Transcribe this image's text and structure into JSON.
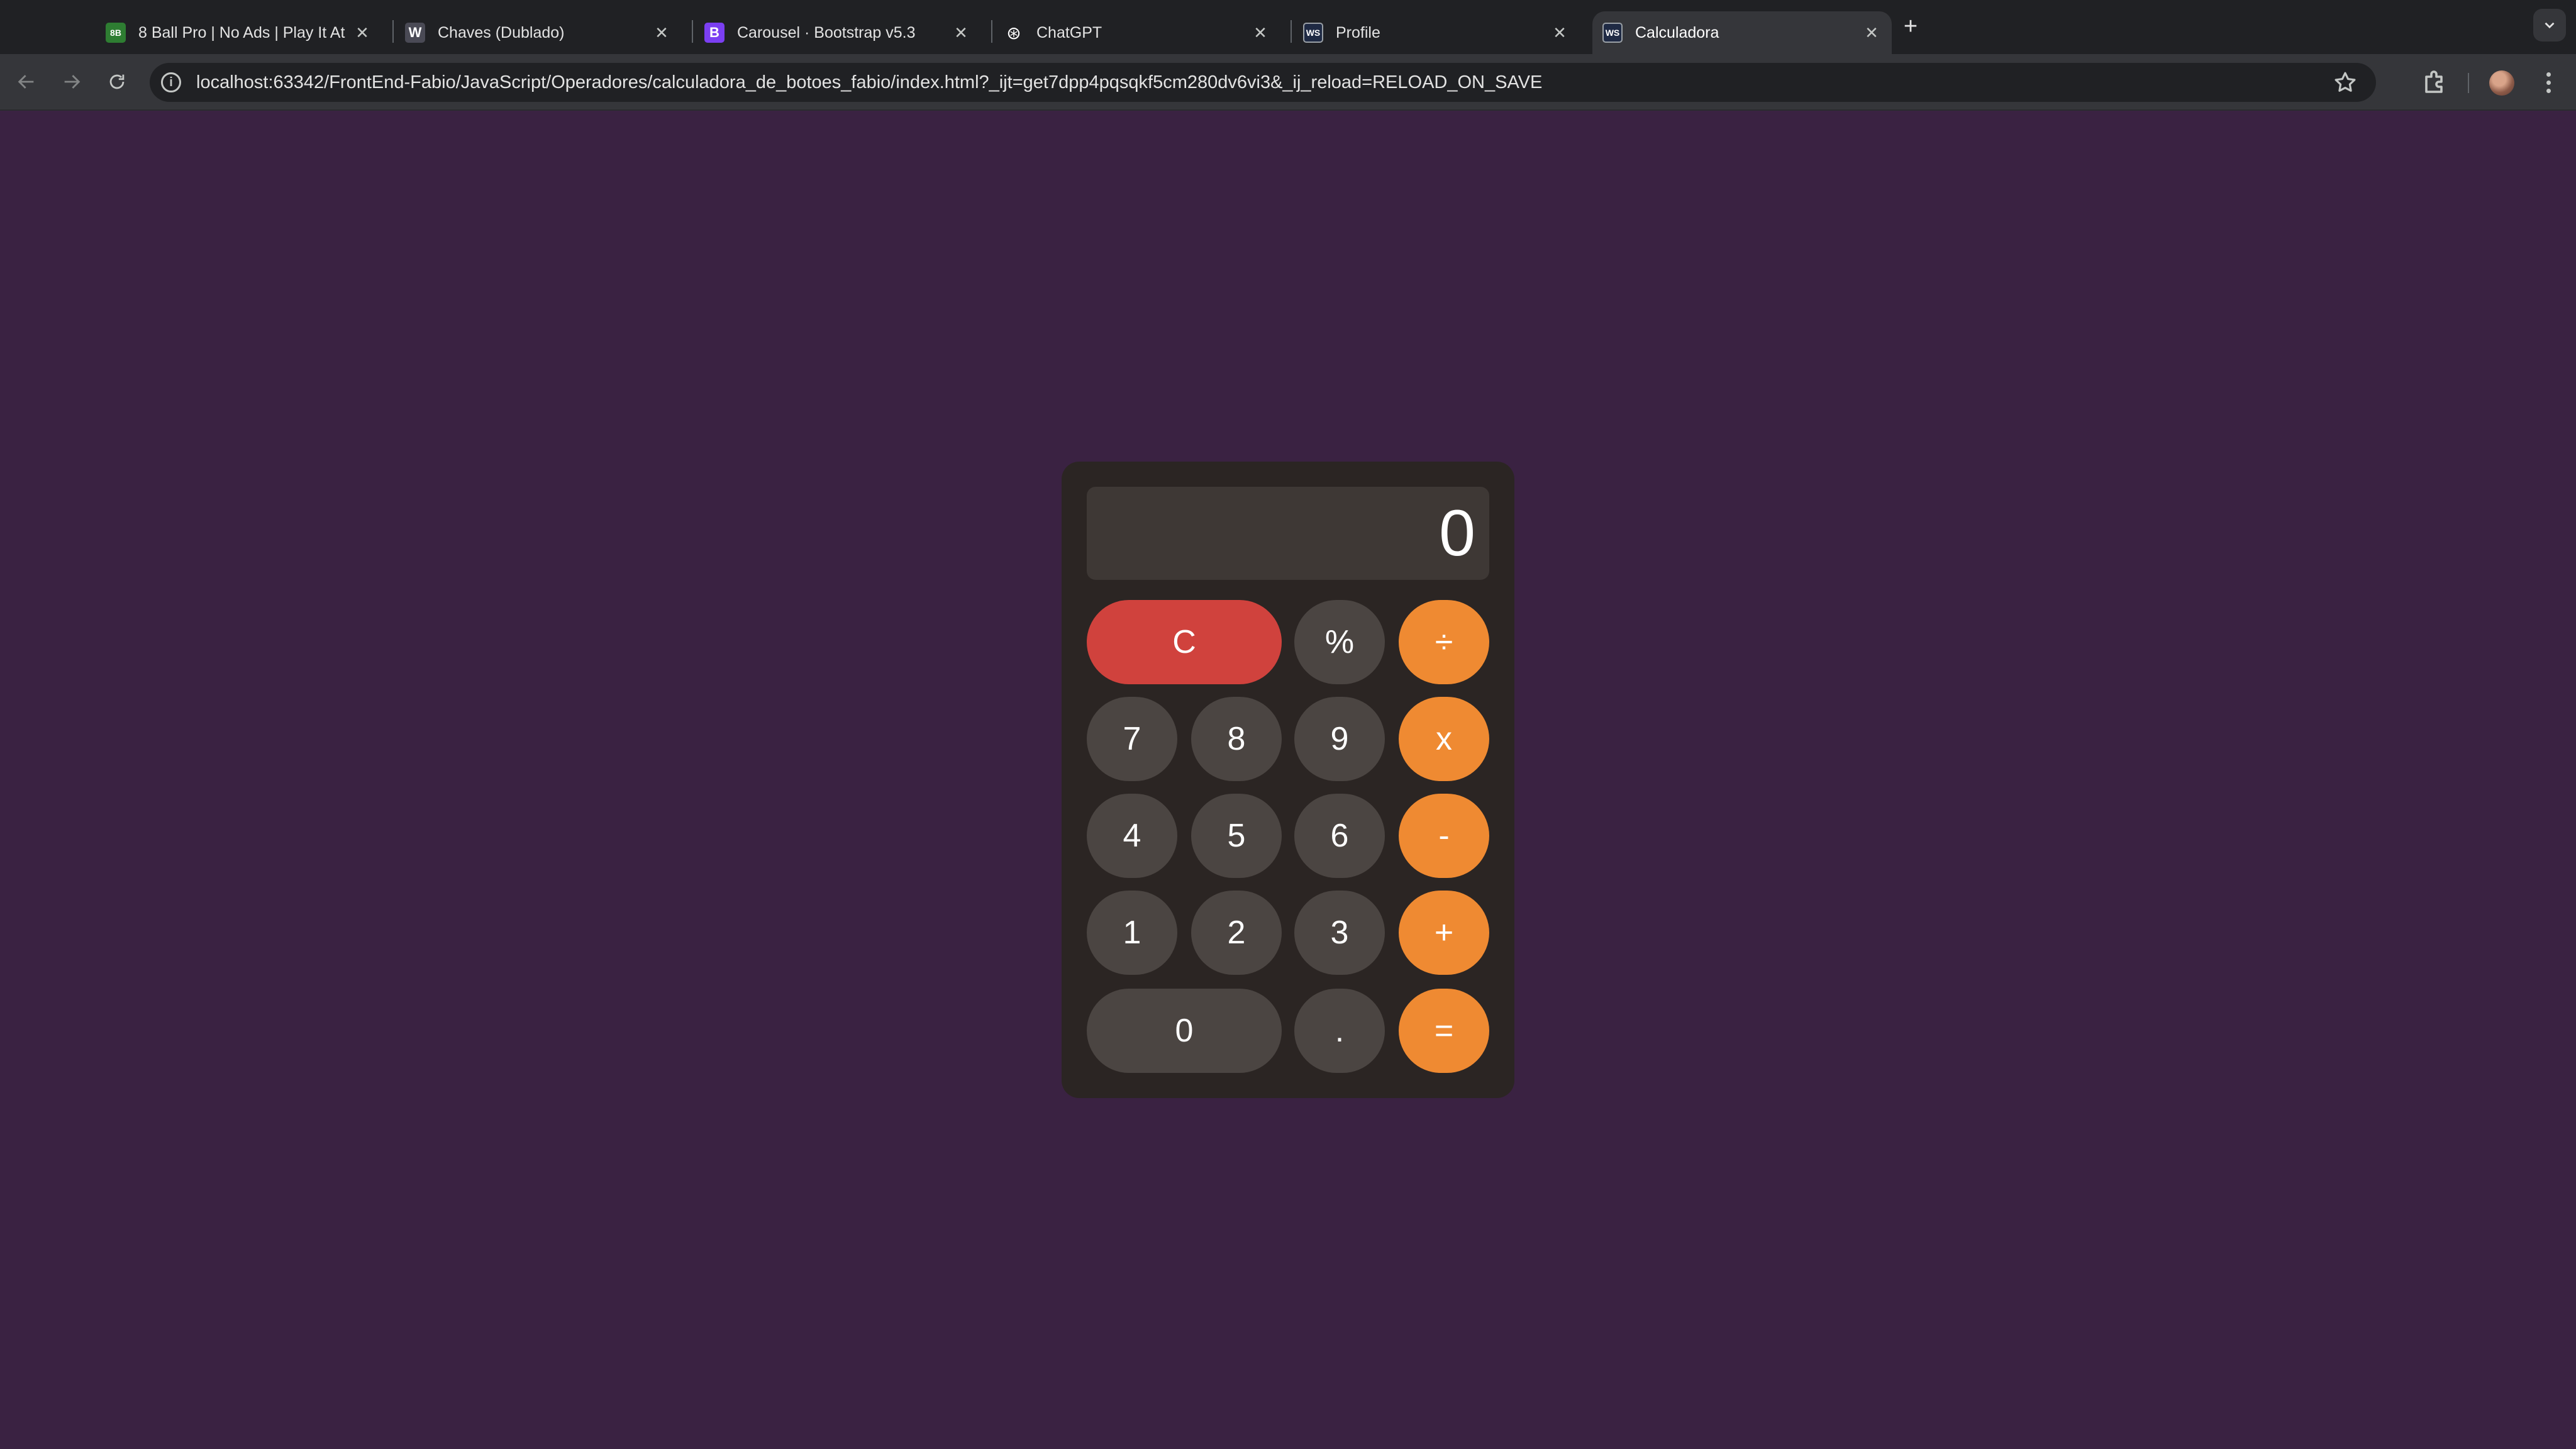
{
  "browser": {
    "tabs": [
      {
        "title": "8 Ball Pro | No Ads | Play It At",
        "favicon": "8B",
        "favicon_color": "#2e7d32"
      },
      {
        "title": "Chaves (Dublado)",
        "favicon": "W",
        "favicon_color": "#4a4a55"
      },
      {
        "title": "Carousel · Bootstrap v5.3",
        "favicon": "B",
        "favicon_color": "#7b3ff2"
      },
      {
        "title": "ChatGPT",
        "favicon": "⊛",
        "favicon_color": "#202124"
      },
      {
        "title": "Profile",
        "favicon": "WS",
        "favicon_color": "#1f2a44"
      },
      {
        "title": "Calculadora",
        "favicon": "WS",
        "favicon_color": "#1f2a44",
        "active": true
      }
    ],
    "url": "localhost:63342/FrontEnd-Fabio/JavaScript/Operadores/calculadora_de_botoes_fabio/index.html?_ijt=get7dpp4pqsqkf5cm280dv6vi3&_ij_reload=RELOAD_ON_SAVE"
  },
  "calculator": {
    "display": "0",
    "keys": {
      "clear": "C",
      "percent": "%",
      "divide": "÷",
      "seven": "7",
      "eight": "8",
      "nine": "9",
      "multiply": "x",
      "four": "4",
      "five": "5",
      "six": "6",
      "minus": "-",
      "one": "1",
      "two": "2",
      "three": "3",
      "plus": "+",
      "zero": "0",
      "decimal": ".",
      "equals": "="
    }
  },
  "colors": {
    "page_background": "#3a2242",
    "calculator_body": "#2b2523",
    "number_key": "#4b4542",
    "operator_key": "#ef8a32",
    "clear_key": "#d0423d"
  }
}
